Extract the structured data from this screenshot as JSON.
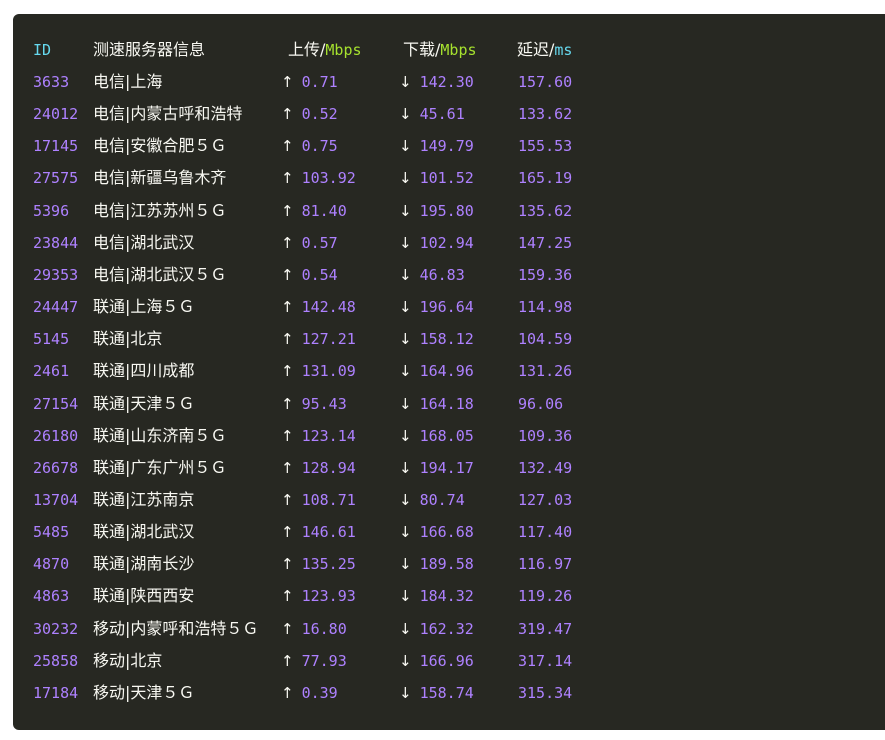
{
  "header": {
    "id": "ID",
    "server": "测速服务器信息",
    "upload": "上传/",
    "upload_unit": "Mbps",
    "download": "下载/",
    "download_unit": "Mbps",
    "latency": "延迟/",
    "latency_unit": "ms"
  },
  "arrows": {
    "up": "↑",
    "down": "↓"
  },
  "rows": [
    {
      "id": "3633",
      "name": "电信|上海",
      "up": "0.71",
      "down": "142.30",
      "lat": "157.60"
    },
    {
      "id": "24012",
      "name": "电信|内蒙古呼和浩特",
      "up": "0.52",
      "down": "45.61",
      "lat": "133.62"
    },
    {
      "id": "17145",
      "name": "电信|安徽合肥５Ｇ",
      "up": "0.75",
      "down": "149.79",
      "lat": "155.53"
    },
    {
      "id": "27575",
      "name": "电信|新疆乌鲁木齐",
      "up": "103.92",
      "down": "101.52",
      "lat": "165.19"
    },
    {
      "id": "5396",
      "name": "电信|江苏苏州５Ｇ",
      "up": "81.40",
      "down": "195.80",
      "lat": "135.62"
    },
    {
      "id": "23844",
      "name": "电信|湖北武汉",
      "up": "0.57",
      "down": "102.94",
      "lat": "147.25"
    },
    {
      "id": "29353",
      "name": "电信|湖北武汉５Ｇ",
      "up": "0.54",
      "down": "46.83",
      "lat": "159.36"
    },
    {
      "id": "24447",
      "name": "联通|上海５Ｇ",
      "up": "142.48",
      "down": "196.64",
      "lat": "114.98"
    },
    {
      "id": "5145",
      "name": "联通|北京",
      "up": "127.21",
      "down": "158.12",
      "lat": "104.59"
    },
    {
      "id": "2461",
      "name": "联通|四川成都",
      "up": "131.09",
      "down": "164.96",
      "lat": "131.26"
    },
    {
      "id": "27154",
      "name": "联通|天津５Ｇ",
      "up": "95.43",
      "down": "164.18",
      "lat": "96.06"
    },
    {
      "id": "26180",
      "name": "联通|山东济南５Ｇ",
      "up": "123.14",
      "down": "168.05",
      "lat": "109.36"
    },
    {
      "id": "26678",
      "name": "联通|广东广州５Ｇ",
      "up": "128.94",
      "down": "194.17",
      "lat": "132.49"
    },
    {
      "id": "13704",
      "name": "联通|江苏南京",
      "up": "108.71",
      "down": "80.74",
      "lat": "127.03"
    },
    {
      "id": "5485",
      "name": "联通|湖北武汉",
      "up": "146.61",
      "down": "166.68",
      "lat": "117.40"
    },
    {
      "id": "4870",
      "name": "联通|湖南长沙",
      "up": "135.25",
      "down": "189.58",
      "lat": "116.97"
    },
    {
      "id": "4863",
      "name": "联通|陕西西安",
      "up": "123.93",
      "down": "184.32",
      "lat": "119.26"
    },
    {
      "id": "30232",
      "name": "移动|内蒙呼和浩特５Ｇ",
      "up": "16.80",
      "down": "162.32",
      "lat": "319.47"
    },
    {
      "id": "25858",
      "name": "移动|北京",
      "up": "77.93",
      "down": "166.96",
      "lat": "317.14"
    },
    {
      "id": "17184",
      "name": "移动|天津５Ｇ",
      "up": "0.39",
      "down": "158.74",
      "lat": "315.34"
    }
  ]
}
